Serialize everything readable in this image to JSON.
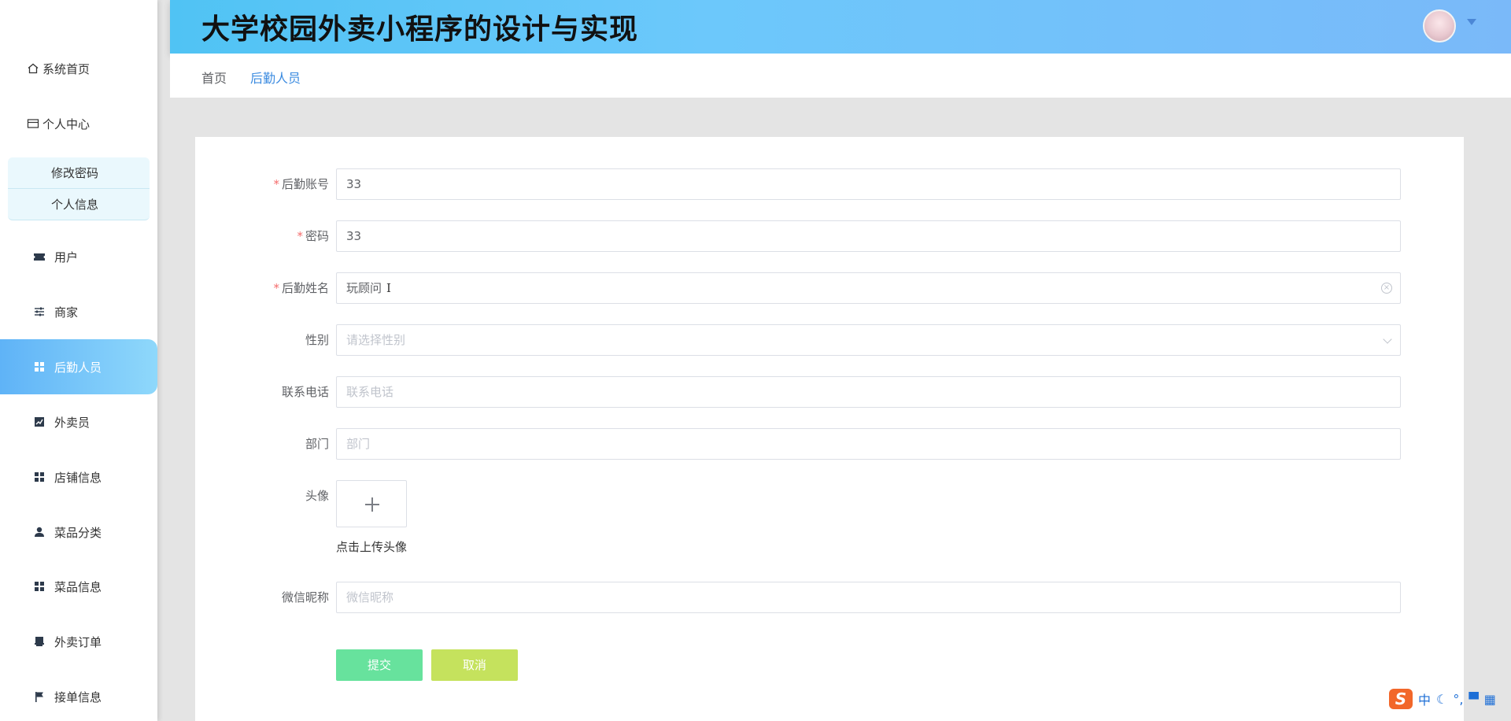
{
  "app": {
    "title": "大学校园外卖小程序的设计与实现"
  },
  "sidebar": {
    "items": [
      {
        "label": "系统首页",
        "icon": "home-icon"
      },
      {
        "label": "个人中心",
        "icon": "wallet-icon"
      },
      {
        "label": "用户",
        "icon": "ticket-icon"
      },
      {
        "label": "商家",
        "icon": "sliders-icon"
      },
      {
        "label": "后勤人员",
        "icon": "grid-icon",
        "active": true
      },
      {
        "label": "外卖员",
        "icon": "chart-icon"
      },
      {
        "label": "店铺信息",
        "icon": "grid-icon"
      },
      {
        "label": "菜品分类",
        "icon": "user-icon"
      },
      {
        "label": "菜品信息",
        "icon": "grid-icon"
      },
      {
        "label": "外卖订单",
        "icon": "printer-icon"
      },
      {
        "label": "接单信息",
        "icon": "flag-icon"
      }
    ],
    "submenu": [
      "修改密码",
      "个人信息"
    ]
  },
  "breadcrumb": {
    "home": "首页",
    "current": "后勤人员"
  },
  "form": {
    "account": {
      "label": "后勤账号",
      "value": "33",
      "required": true
    },
    "password": {
      "label": "密码",
      "value": "33",
      "required": true
    },
    "name": {
      "label": "后勤姓名",
      "value": "玩顾问",
      "required": true
    },
    "gender": {
      "label": "性别",
      "placeholder": "请选择性别"
    },
    "phone": {
      "label": "联系电话",
      "placeholder": "联系电话"
    },
    "department": {
      "label": "部门",
      "placeholder": "部门"
    },
    "avatar": {
      "label": "头像",
      "hint": "点击上传头像"
    },
    "wechat": {
      "label": "微信昵称",
      "placeholder": "微信昵称"
    },
    "submit_label": "提交",
    "cancel_label": "取消"
  },
  "ime": {
    "logo": "S",
    "mode": "中",
    "icons": [
      "moon-icon",
      "punctuation-icon",
      "shirt-icon",
      "grid-icon"
    ]
  },
  "colors": {
    "header_start": "#50c3f4",
    "header_end": "#7ab9f9",
    "active_item": "#5fb3f7",
    "submit": "#67e29d",
    "cancel": "#c5e25d",
    "link": "#3b8be0",
    "required": "#f56c6c"
  }
}
